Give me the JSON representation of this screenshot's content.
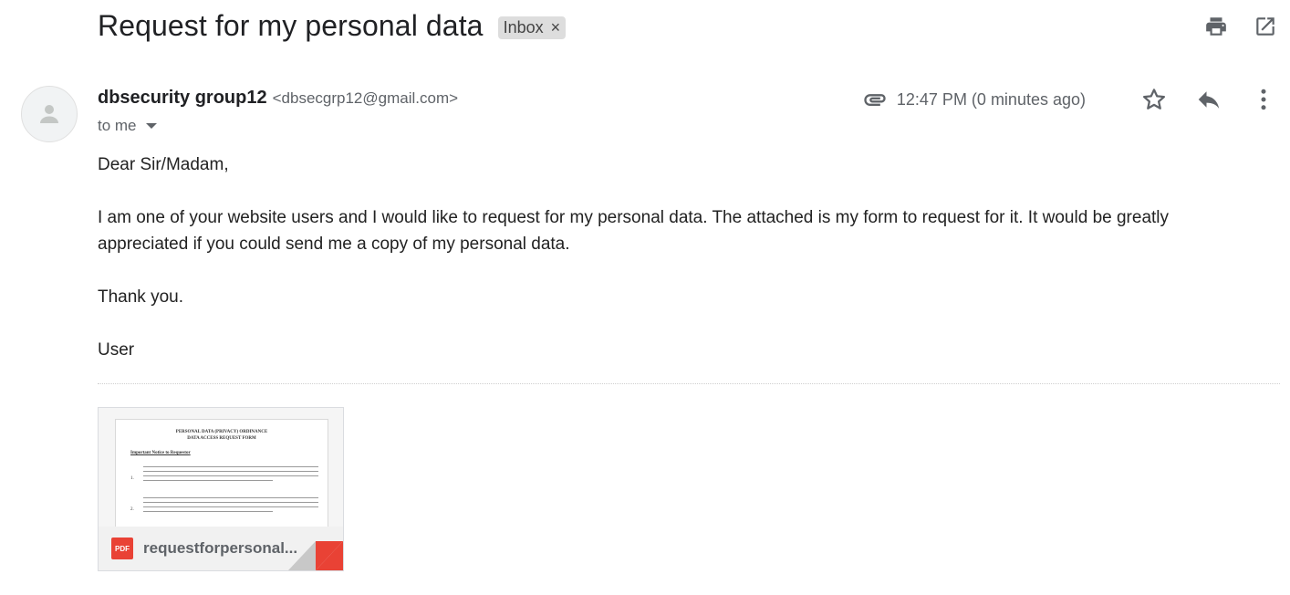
{
  "subject": {
    "title": "Request for my personal data",
    "label": "Inbox",
    "label_remove": "×"
  },
  "toolbar": {
    "icons": [
      "print-icon",
      "open-in-new-window-icon"
    ]
  },
  "sender": {
    "name": "dbsecurity group12",
    "email": "<dbsecgrp12@gmail.com>",
    "to": "to me"
  },
  "meta": {
    "timestamp": "12:47 PM (0 minutes ago)",
    "icons": [
      "attachment-clip-icon",
      "star-icon",
      "reply-icon",
      "more-options-icon"
    ]
  },
  "body": {
    "greeting": "Dear Sir/Madam,",
    "paragraph": "I am one of your website users and I would like to request for my personal data. The attached is my form to request for it. It would be greatly appreciated if you could send me a copy of my personal data.",
    "thanks": "Thank you.",
    "signature": "User"
  },
  "attachment": {
    "filename": "requestforpersonal...",
    "type_badge": "PDF",
    "preview": {
      "title_line1": "PERSONAL DATA (PRIVACY) ORDINANCE",
      "title_line2": "DATA ACCESS REQUEST FORM",
      "notice": "Important Notice to Requestor",
      "item1": "1.",
      "item2": "2."
    }
  },
  "colors": {
    "label_chip_bg": "#dddddd",
    "pdf_red": "#e94235",
    "text_secondary": "#5f6368"
  }
}
